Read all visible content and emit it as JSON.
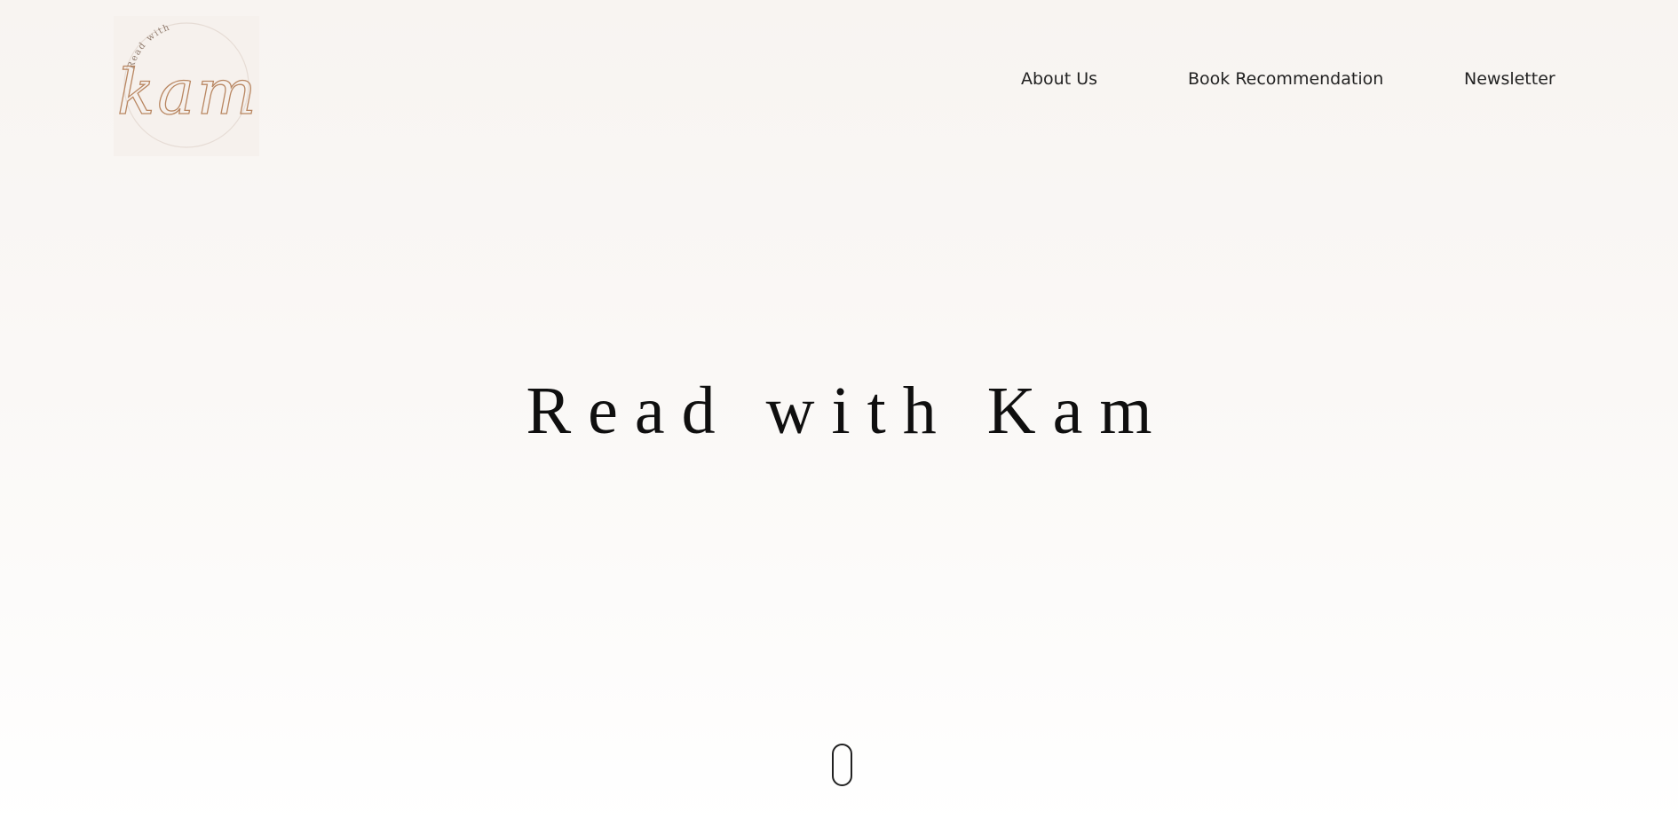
{
  "brand": {
    "logo_arc_text": "Read with",
    "logo_script_text": "kam",
    "accent_color": "#b98762"
  },
  "nav": {
    "items": [
      {
        "label": "About Us"
      },
      {
        "label": "Book Recommendation"
      },
      {
        "label": "Newsletter"
      }
    ]
  },
  "hero": {
    "title": "Read with Kam"
  },
  "scroll_indicator": {
    "icon": "scroll-mouse-icon"
  }
}
